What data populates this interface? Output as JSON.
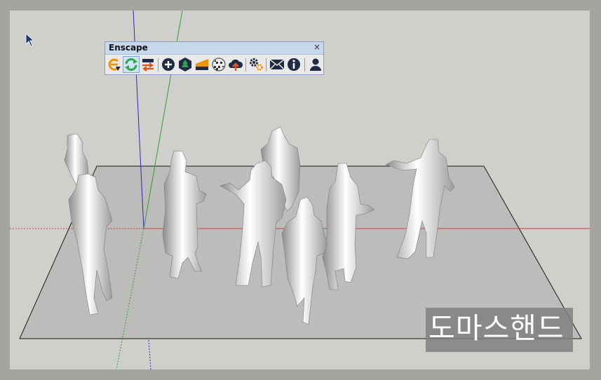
{
  "toolbar": {
    "title": "Enscape",
    "close_glyph": "×",
    "buttons": [
      {
        "name": "enscape-logo-icon",
        "color": "#f39200"
      },
      {
        "name": "live-update-icon",
        "color": "#2aa84a"
      },
      {
        "name": "sync-views-icon",
        "color": "#e2571e"
      },
      {
        "name": "add-asset-icon",
        "color": "#1f2a44"
      },
      {
        "name": "asset-library-icon",
        "color": "#2aa84a"
      },
      {
        "name": "visual-settings-icon",
        "color": "#f39200"
      },
      {
        "name": "material-editor-icon",
        "color": "#333333"
      },
      {
        "name": "upload-cloud-icon",
        "color": "#e2571e"
      },
      {
        "name": "settings-gear-icon",
        "color": "#f39200"
      },
      {
        "name": "feedback-mail-icon",
        "color": "#1f2a44"
      },
      {
        "name": "about-info-icon",
        "color": "#1f2a44"
      },
      {
        "name": "account-user-icon",
        "color": "#1f2a44"
      }
    ]
  },
  "watermark": {
    "text": "도마스핸드"
  },
  "scene": {
    "ground_fill": "#bcbcba",
    "figures_count": 7
  }
}
